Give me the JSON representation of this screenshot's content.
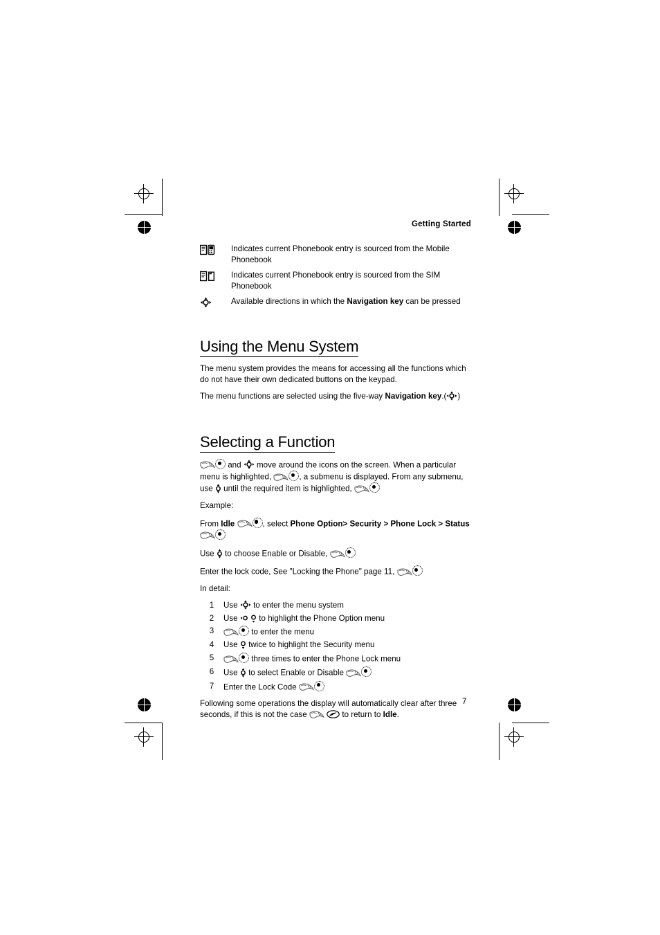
{
  "document": {
    "running_head": "Getting Started",
    "page_number": "7"
  },
  "legend": [
    {
      "icon": "mobile-phonebook-icon",
      "text": "Indicates current Phonebook entry is sourced from the Mobile Phonebook"
    },
    {
      "icon": "sim-phonebook-icon",
      "text": "Indicates current Phonebook entry is sourced from the SIM Phonebook"
    },
    {
      "icon": "navigation-key-4way-icon",
      "text_before": "Available directions in which the ",
      "text_bold": "Navigation key",
      "text_after": " can be pressed"
    }
  ],
  "sections": {
    "menu_system": {
      "heading": "Using the Menu System",
      "paragraph1": "The menu system provides the means for accessing all the functions which do not have their own dedicated buttons on the keypad.",
      "paragraph2_before": "The menu functions are selected using the five-way ",
      "paragraph2_bold": "Navigation key",
      "paragraph2_after": ".(",
      "paragraph2_end": ")"
    },
    "selecting_function": {
      "heading": "Selecting a Function",
      "intro_1": " and ",
      "intro_2": " move around the icons on the screen.  When a particular menu is highlighted, ",
      "intro_3": ", a submenu is displayed. From any submenu, use ",
      "intro_4": " until the required item is highlighted, ",
      "example_label": "Example:",
      "example_line_from": "From ",
      "example_idle": "Idle",
      "example_select": ", select ",
      "example_path_1": "Phone Option",
      "example_path_2": "> ",
      "example_path_3": "Security",
      "example_path_4": " > ",
      "example_path_5": "Phone Lock",
      "example_path_6": " > ",
      "example_path_7": "Status",
      "use_enable_disable_before": "Use ",
      "use_enable_disable_after": " to choose Enable or Disable, ",
      "lock_code_line": "Enter the lock code, See \"Locking the Phone\" page 11, ",
      "in_detail_label": "In detail:",
      "steps": [
        {
          "num": "1",
          "before": "Use ",
          "icon": "navigation-key-4way-icon",
          "after": " to enter the menu system"
        },
        {
          "num": "2",
          "before": "Use ",
          "icon": "navigation-key-left-down-icon",
          "after": " to highlight the Phone Option menu"
        },
        {
          "num": "3",
          "before": "",
          "icon": "softkey-select-icon",
          "after": " to enter the menu"
        },
        {
          "num": "4",
          "before": "Use ",
          "icon": "navigation-key-down-icon",
          "after": " twice to highlight the Security menu"
        },
        {
          "num": "5",
          "before": "",
          "icon": "softkey-select-icon",
          "after": " three times to enter the Phone Lock menu"
        },
        {
          "num": "6",
          "before": "Use ",
          "icon": "navigation-key-up-down-icon",
          "after": " to select Enable or Disable "
        },
        {
          "num": "7",
          "before": "Enter the Lock Code ",
          "icon": "softkey-select-icon",
          "after": ""
        }
      ],
      "closing_before": "Following some operations the display will automatically clear after three seconds, if this is not the case ",
      "closing_middle": " to return to ",
      "closing_bold": "Idle",
      "closing_after": "."
    }
  }
}
